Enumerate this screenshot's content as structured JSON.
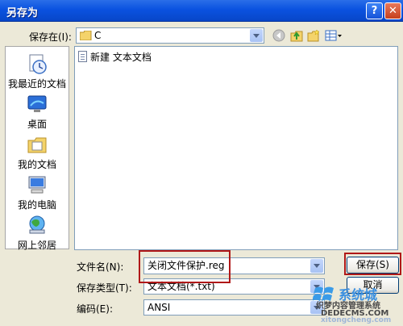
{
  "window": {
    "title": "另存为",
    "help_symbol": "?",
    "close_symbol": "✕"
  },
  "toolbar": {
    "save_in_label": "保存在(I):",
    "save_in_value": "C",
    "icons": [
      "folder-icon",
      "back-icon",
      "up-folder-icon",
      "new-folder-icon",
      "views-menu-icon"
    ]
  },
  "places": [
    {
      "label": "我最近的文档",
      "icon": "recent-documents-icon"
    },
    {
      "label": "桌面",
      "icon": "desktop-icon"
    },
    {
      "label": "我的文档",
      "icon": "my-documents-icon"
    },
    {
      "label": "我的电脑",
      "icon": "my-computer-icon"
    },
    {
      "label": "网上邻居",
      "icon": "network-places-icon"
    }
  ],
  "files": [
    {
      "name": "新建 文本文档",
      "icon": "text-file-icon"
    }
  ],
  "form": {
    "filename_label": "文件名(N):",
    "filename_value": "关闭文件保护.reg",
    "filetype_label": "保存类型(T):",
    "filetype_value": "文本文档(*.txt)",
    "encoding_label": "编码(E):",
    "encoding_value": "ANSI"
  },
  "buttons": {
    "save": "保存(S)",
    "cancel": "取消"
  },
  "watermark": {
    "logo_text": "系统城",
    "url_partial": "xitongcheng.com",
    "site_line1": "织梦内容管理系统",
    "site_line2": "DEDECMS.COM"
  },
  "colors": {
    "highlight_box": "#b01818",
    "titlebar": "#0a52e0"
  }
}
